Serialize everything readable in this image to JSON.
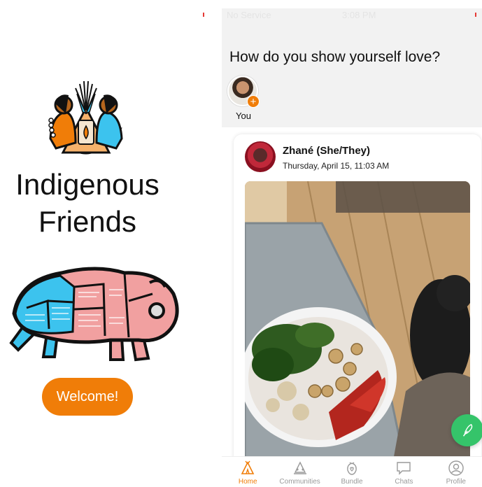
{
  "left": {
    "title_line1": "Indigenous",
    "title_line2": "Friends",
    "welcome_label": "Welcome!"
  },
  "status": {
    "carrier": "No Service",
    "time": "3:08 PM"
  },
  "feed": {
    "question": "How do you show yourself love?",
    "story": {
      "label": "You",
      "badge": "+"
    },
    "post": {
      "author": "Zhané (She/They)",
      "date": "Thursday, April 15, 11:03 AM"
    }
  },
  "tabs": [
    {
      "label": "Home",
      "icon": "teepee-icon",
      "active": true
    },
    {
      "label": "Communities",
      "icon": "communities-icon",
      "active": false
    },
    {
      "label": "Bundle",
      "icon": "bundle-icon",
      "active": false
    },
    {
      "label": "Chats",
      "icon": "chat-bubble-icon",
      "active": false
    },
    {
      "label": "Profile",
      "icon": "profile-icon",
      "active": false
    }
  ],
  "colors": {
    "accent": "#f07d08",
    "fab": "#35c46a",
    "header_bg": "#f2f2f2",
    "bison_red": "#f1a0a0",
    "bison_blue": "#3cc3ee"
  }
}
